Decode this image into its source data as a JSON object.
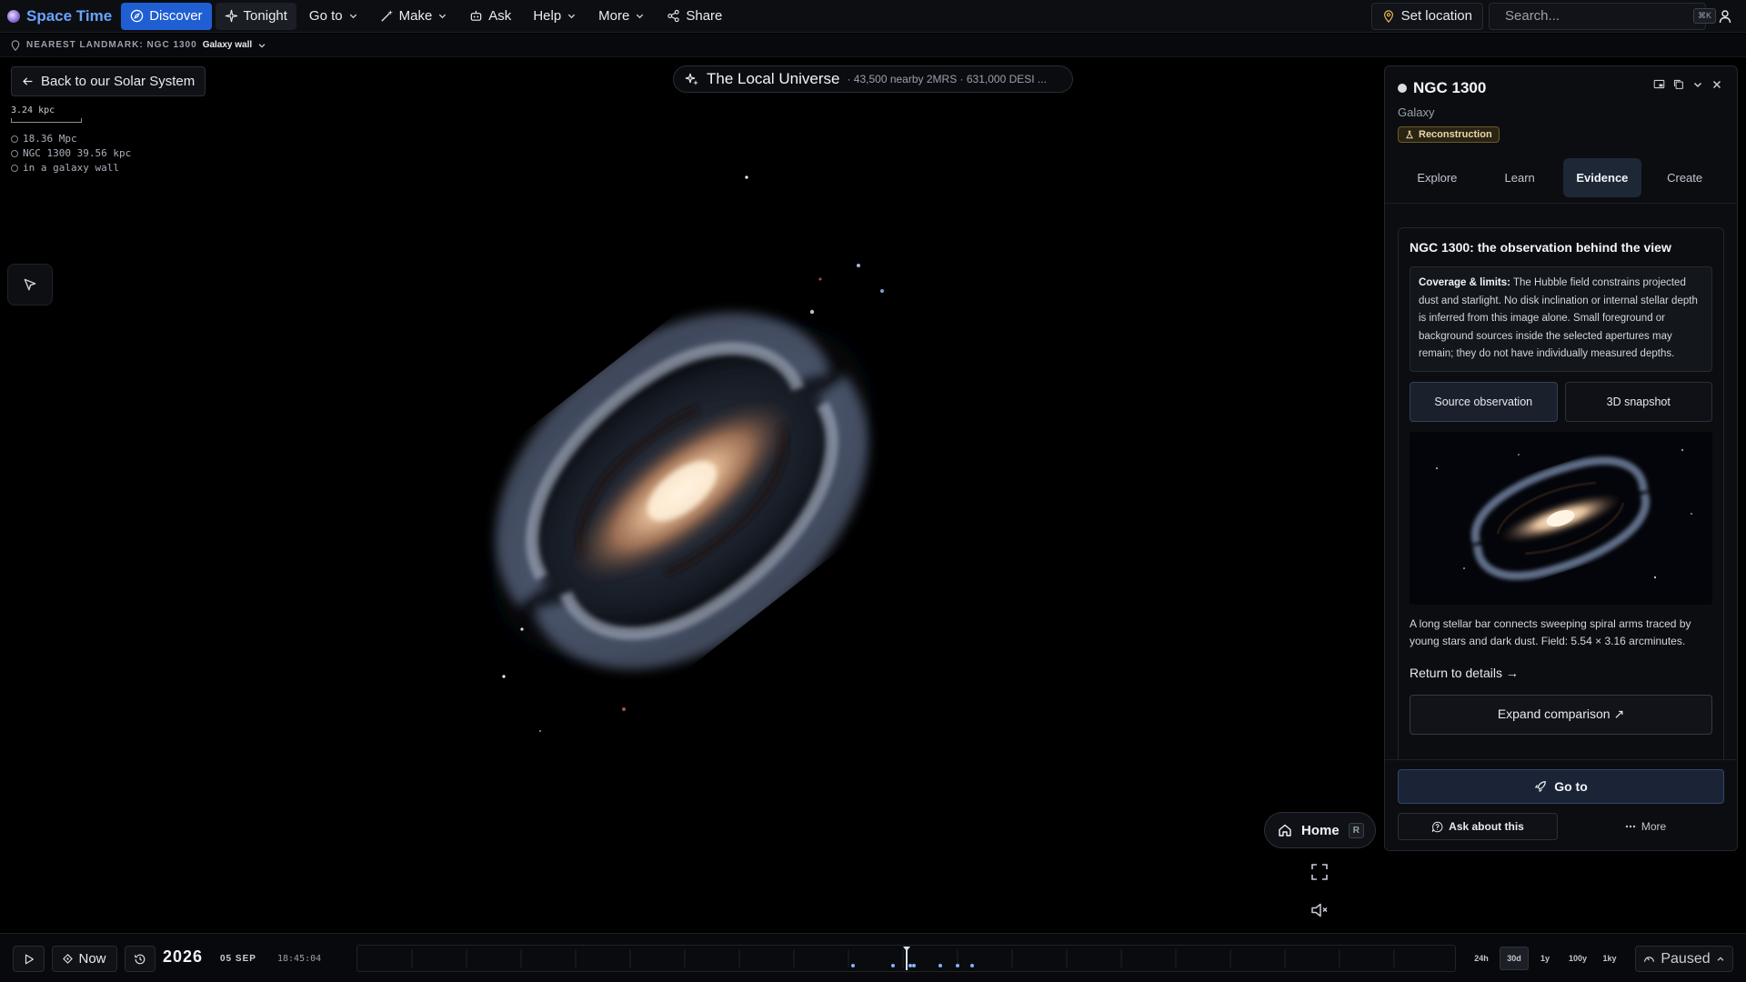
{
  "app": {
    "name": "Space Time"
  },
  "nav": {
    "discover": "Discover",
    "tonight": "Tonight",
    "goto": "Go to",
    "make": "Make",
    "ask": "Ask",
    "help": "Help",
    "more": "More",
    "share": "Share"
  },
  "top_right": {
    "set_location": "Set location",
    "search_placeholder": "Search...",
    "search_shortcut": "⌘K"
  },
  "landmark": {
    "label": "NEAREST LANDMARK: NGC 1300",
    "value": "Galaxy wall"
  },
  "left": {
    "back": "Back to our Solar System",
    "scale": "3.24 kpc",
    "coords": [
      "18.36 Mpc",
      "NGC 1300 39.56 kpc",
      "in a galaxy wall"
    ]
  },
  "scene": {
    "title": "The Local Universe",
    "subtitle": "· 43,500 nearby 2MRS · 631,000 DESI ..."
  },
  "panel": {
    "name": "NGC 1300",
    "type": "Galaxy",
    "badge": "Reconstruction",
    "tabs": [
      "Explore",
      "Learn",
      "Evidence",
      "Create"
    ],
    "active_tab": "Evidence",
    "card_title": "NGC 1300: the observation behind the view",
    "limits_label": "Coverage & limits:",
    "limits_text": "The Hubble field constrains projected dust and starlight. No disk inclination or internal stellar depth is inferred from this image alone. Small foreground or background sources inside the selected apertures may remain; they do not have individually measured depths.",
    "btn_source": "Source observation",
    "btn_snapshot": "3D snapshot",
    "caption": "A long stellar bar connects sweeping spiral arms traced by young stars and dark dust. Field: 5.54 × 3.16 arcminutes.",
    "return": "Return to details →",
    "expand": "Expand comparison ↗",
    "goto": "Go to",
    "ask": "Ask about this",
    "more": "More"
  },
  "controls": {
    "home": "Home",
    "home_key": "R"
  },
  "timeline": {
    "now": "Now",
    "year": "2026",
    "date": "05 SEP",
    "time": "18:45:04",
    "ranges": [
      "24h",
      "30d",
      "1y",
      "100y",
      "1ky"
    ],
    "selected_range": "30d",
    "state": "Paused"
  },
  "colors": {
    "accent": "#1f5fd3",
    "brand": "#6aa3ff",
    "badge": "#e9d9a8"
  }
}
